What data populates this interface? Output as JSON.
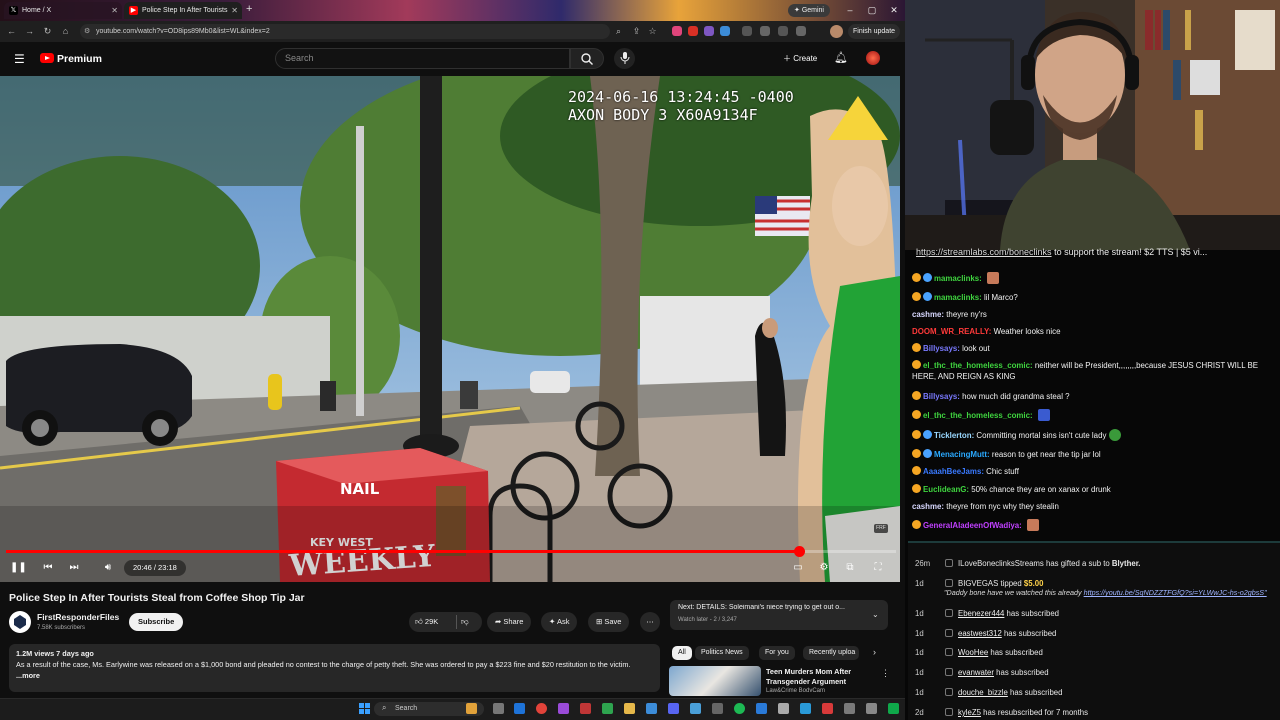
{
  "browser": {
    "tabs": [
      {
        "label": "Home / X",
        "favicon": "x-logo-icon"
      },
      {
        "label": "Police Step In After Tourists",
        "favicon": "youtube-icon"
      }
    ],
    "gemini_label": "Gemini",
    "url": "youtube.com/watch?v=OD8ips89Mb0&list=WL&index=2",
    "finish_update": "Finish update"
  },
  "youtube": {
    "logo_text": "Premium",
    "search_placeholder": "Search",
    "create_label": "Create"
  },
  "video": {
    "timestamp_line1": "2024-06-16 13:24:45 -0400",
    "timestamp_line2": "AXON BODY 3 X60A9134F",
    "box_text_1": "NAIL",
    "box_text_2": "KEY WEST",
    "box_text_3": "WEEKLY",
    "time": "20:46 / 23:18",
    "progress": 0.891,
    "title": "Police Step In After Tourists Steal from Coffee Shop Tip Jar",
    "channel": "FirstResponderFiles",
    "subscribers": "7.58K subscribers",
    "subscribe_label": "Subscribe",
    "likes": "29K",
    "share_label": "Share",
    "ask_label": "Ask",
    "save_label": "Save",
    "views_date": "1.2M views  7 days ago",
    "description": "As a result of the case, Ms. Earlywine was released on a $1,000 bond and pleaded no contest to the charge of petty theft. She was ordered to pay a $223 fine and $20 restitution to the victim.",
    "more_label": "...more"
  },
  "sidebar": {
    "next_title": "Next: DETAILS: Soleimani's niece trying to get out o...",
    "next_sub": "Watch later - 2 / 3,247",
    "chips": [
      "All",
      "Politics News",
      "For you",
      "Recently uploa"
    ],
    "recommended_title": "Teen Murders Mom After Transgender Argument",
    "recommended_channel": "Law&Crime BodyCam"
  },
  "taskbar": {
    "search_placeholder": "Search"
  },
  "stream": {
    "banner_link": "https://streamlabs.com/boneclinks",
    "banner_rest": " to support the stream! $2 TTS | $5 vi..."
  },
  "chat": [
    {
      "user": "mamaclinks:",
      "color": "#3fd43f",
      "msg": ""
    },
    {
      "user": "mamaclinks:",
      "color": "#3fd43f",
      "msg": "lil Marco?"
    },
    {
      "user": "cashme:",
      "color": "#d8d8ff",
      "msg": "theyre ny'rs"
    },
    {
      "user": "DOOM_WR_REALLY:",
      "color": "#ff3a3a",
      "msg": "Weather looks nice"
    },
    {
      "user": "Billysays:",
      "color": "#7a7aff",
      "msg": "look out"
    },
    {
      "user": "el_thc_the_homeless_comic:",
      "color": "#3fd43f",
      "msg": "neither will be President,,,,,,,,because JESUS CHRIST WILL BE HERE, AND REIGN AS KING"
    },
    {
      "user": "Billysays:",
      "color": "#7a7aff",
      "msg": "how much did grandma steal ?"
    },
    {
      "user": "el_thc_the_homeless_comic:",
      "color": "#3fd43f",
      "msg": ""
    },
    {
      "user": "Ticklerton:",
      "color": "#9ad8ff",
      "msg": "Committing mortal sins isn't cute lady"
    },
    {
      "user": "MenacingMutt:",
      "color": "#2aa9ff",
      "msg": "reason to get near the tip jar lol"
    },
    {
      "user": "AaaahBeeJams:",
      "color": "#3a7aff",
      "msg": "Chic stuff"
    },
    {
      "user": "EuclideanG:",
      "color": "#3fd43f",
      "msg": "50% chance they are on xanax or drunk"
    },
    {
      "user": "cashme:",
      "color": "#d8d8ff",
      "msg": "theyre from nyc why they stealin"
    },
    {
      "user": "GeneralAladeenOfWadiya:",
      "color": "#c040ff",
      "msg": ""
    }
  ],
  "events": [
    {
      "time": "26m",
      "name": "ILoveBoneclinksStreams",
      "text": " has gifted a sub to ",
      "extra": "Blyther."
    },
    {
      "time": "1d",
      "name": "BIGVEGAS",
      "text": " tipped ",
      "extra": "$5.00"
    },
    {
      "time": "1d",
      "name": "Ebenezer444",
      "text": " has subscribed",
      "extra": ""
    },
    {
      "time": "1d",
      "name": "eastwest312",
      "text": " has subscribed",
      "extra": ""
    },
    {
      "time": "1d",
      "name": "WooHee",
      "text": " has subscribed",
      "extra": ""
    },
    {
      "time": "1d",
      "name": "evanwater",
      "text": " has subscribed",
      "extra": ""
    },
    {
      "time": "1d",
      "name": "douche_bizzle",
      "text": " has subscribed",
      "extra": ""
    },
    {
      "time": "2d",
      "name": "kyleZ5",
      "text": " has resubscribed for 7 months",
      "extra": ""
    }
  ],
  "event_quote": "\"Daddy bone have we watched this already ",
  "event_quote_link": "https://youtu.be/SqNDZZTFGfQ?si=YLWwJC-hs-o2gbsS\"",
  "colors": {
    "accent": "#ff0000",
    "yt_bg": "#0f0f0f",
    "chat_bg": "#070707"
  }
}
